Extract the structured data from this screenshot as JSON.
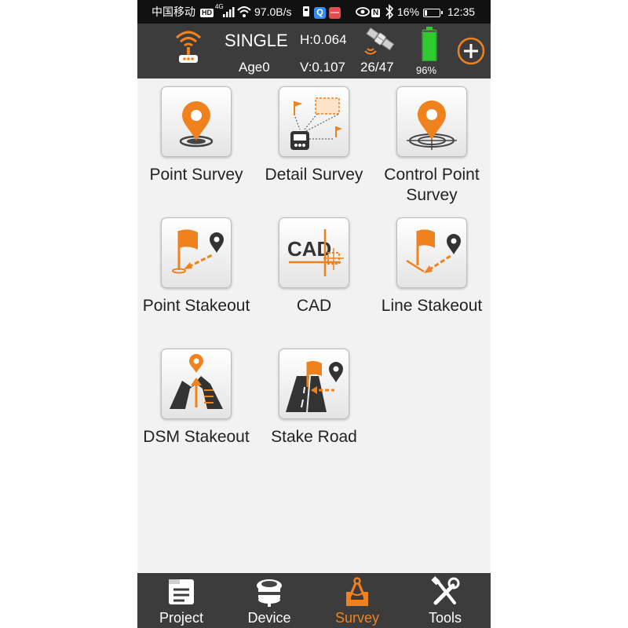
{
  "status_bar": {
    "carrier": "中国移动",
    "hd_badge": "HD",
    "network": "4G",
    "speed": "97.0B/s",
    "nfc": "N",
    "battery_percent_text": "16%",
    "battery_level": 0.16,
    "time": "12:35"
  },
  "header": {
    "fix_status": "SINGLE",
    "age": "Age0",
    "h_precision": "H:0.064",
    "v_precision": "V:0.107",
    "satellites": "26/47",
    "device_battery_text": "96%",
    "device_battery_level": 0.96
  },
  "tiles": [
    {
      "label": "Point Survey"
    },
    {
      "label": "Detail Survey"
    },
    {
      "label": "Control Point Survey"
    },
    {
      "label": "Point Stakeout"
    },
    {
      "label": "CAD"
    },
    {
      "label": "Line Stakeout"
    },
    {
      "label": "DSM Stakeout"
    },
    {
      "label": "Stake Road"
    }
  ],
  "cad_icon_text": "CAD",
  "bottom_nav": [
    {
      "label": "Project",
      "active": false
    },
    {
      "label": "Device",
      "active": false
    },
    {
      "label": "Survey",
      "active": true
    },
    {
      "label": "Tools",
      "active": false
    }
  ],
  "colors": {
    "accent": "#f0821e",
    "header_bg": "#3c3c3c",
    "battery_green": "#2ecc2e"
  }
}
